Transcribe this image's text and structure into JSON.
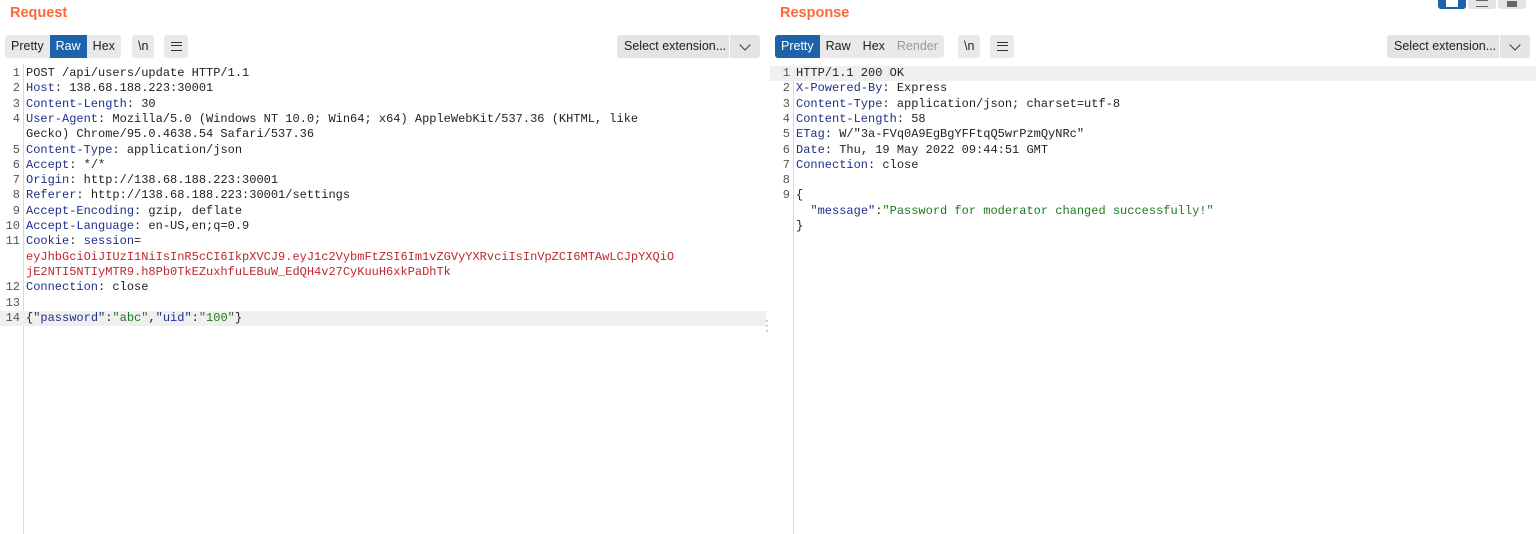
{
  "request": {
    "title": "Request",
    "tabs": [
      "Pretty",
      "Raw",
      "Hex"
    ],
    "active_tab": "Raw",
    "newline_label": "\\n",
    "extension_label": "Select extension...",
    "lines": [
      {
        "n": "1",
        "segs": [
          {
            "t": "POST /api/users/update HTTP/1.1"
          }
        ]
      },
      {
        "n": "2",
        "segs": [
          {
            "t": "Host",
            "c": "k"
          },
          {
            "t": ": 138.68.188.223:30001"
          }
        ]
      },
      {
        "n": "3",
        "segs": [
          {
            "t": "Content-Length",
            "c": "k"
          },
          {
            "t": ": 30"
          }
        ]
      },
      {
        "n": "4",
        "segs": [
          {
            "t": "User-Agent",
            "c": "k"
          },
          {
            "t": ": Mozilla/5.0 (Windows NT 10.0; Win64; x64) AppleWebKit/537.36 (KHTML, like"
          }
        ]
      },
      {
        "n": "",
        "segs": [
          {
            "t": "Gecko) Chrome/95.0.4638.54 Safari/537.36"
          }
        ]
      },
      {
        "n": "5",
        "segs": [
          {
            "t": "Content-Type",
            "c": "k"
          },
          {
            "t": ": application/json"
          }
        ]
      },
      {
        "n": "6",
        "segs": [
          {
            "t": "Accept",
            "c": "k"
          },
          {
            "t": ": */*"
          }
        ]
      },
      {
        "n": "7",
        "segs": [
          {
            "t": "Origin",
            "c": "k"
          },
          {
            "t": ": http://138.68.188.223:30001"
          }
        ]
      },
      {
        "n": "8",
        "segs": [
          {
            "t": "Referer",
            "c": "k"
          },
          {
            "t": ": http://138.68.188.223:30001/settings"
          }
        ]
      },
      {
        "n": "9",
        "segs": [
          {
            "t": "Accept-Encoding",
            "c": "k"
          },
          {
            "t": ": gzip, deflate"
          }
        ]
      },
      {
        "n": "10",
        "segs": [
          {
            "t": "Accept-Language",
            "c": "k"
          },
          {
            "t": ": en-US,en;q=0.9"
          }
        ]
      },
      {
        "n": "11",
        "segs": [
          {
            "t": "Cookie",
            "c": "k"
          },
          {
            "t": ": "
          },
          {
            "t": "session",
            "c": "k"
          },
          {
            "t": "="
          }
        ]
      },
      {
        "n": "",
        "segs": [
          {
            "t": "eyJhbGciOiJIUzI1NiIsInR5cCI6IkpXVCJ9.eyJ1c2VybmFtZSI6Im1vZGVyYXRvciIsInVpZCI6MTAwLCJpYXQiO",
            "c": "red"
          }
        ]
      },
      {
        "n": "",
        "segs": [
          {
            "t": "jE2NTI5NTIyMTR9.h8Pb0TkEZuxhfuLEBuW_EdQH4v27CyKuuH6xkPaDhTk",
            "c": "red"
          }
        ]
      },
      {
        "n": "12",
        "segs": [
          {
            "t": "Connection",
            "c": "k"
          },
          {
            "t": ": close"
          }
        ]
      },
      {
        "n": "13",
        "segs": []
      },
      {
        "n": "14",
        "hl": true,
        "segs": [
          {
            "t": "{"
          },
          {
            "t": "\"password\"",
            "c": "jk"
          },
          {
            "t": ":"
          },
          {
            "t": "\"abc\"",
            "c": "js"
          },
          {
            "t": ","
          },
          {
            "t": "\"uid\"",
            "c": "jk"
          },
          {
            "t": ":"
          },
          {
            "t": "\"100\"",
            "c": "js"
          },
          {
            "t": "}"
          }
        ]
      }
    ]
  },
  "response": {
    "title": "Response",
    "tabs": [
      "Pretty",
      "Raw",
      "Hex",
      "Render"
    ],
    "active_tab": "Pretty",
    "disabled_tab": "Render",
    "newline_label": "\\n",
    "extension_label": "Select extension...",
    "lines": [
      {
        "n": "1",
        "hl": true,
        "segs": [
          {
            "t": "HTTP/1.1 200 OK"
          }
        ]
      },
      {
        "n": "2",
        "segs": [
          {
            "t": "X-Powered-By",
            "c": "k"
          },
          {
            "t": ": Express"
          }
        ]
      },
      {
        "n": "3",
        "segs": [
          {
            "t": "Content-Type",
            "c": "k"
          },
          {
            "t": ": application/json; charset=utf-8"
          }
        ]
      },
      {
        "n": "4",
        "segs": [
          {
            "t": "Content-Length",
            "c": "k"
          },
          {
            "t": ": 58"
          }
        ]
      },
      {
        "n": "5",
        "segs": [
          {
            "t": "ETag",
            "c": "k"
          },
          {
            "t": ": W/\"3a-FVq0A9EgBgYFFtqQ5wrPzmQyNRc\""
          }
        ]
      },
      {
        "n": "6",
        "segs": [
          {
            "t": "Date",
            "c": "k"
          },
          {
            "t": ": Thu, 19 May 2022 09:44:51 GMT"
          }
        ]
      },
      {
        "n": "7",
        "segs": [
          {
            "t": "Connection",
            "c": "k"
          },
          {
            "t": ": close"
          }
        ]
      },
      {
        "n": "8",
        "segs": []
      },
      {
        "n": "9",
        "segs": [
          {
            "t": "{"
          }
        ]
      },
      {
        "n": "",
        "segs": [
          {
            "t": "  "
          },
          {
            "t": "\"message\"",
            "c": "jk"
          },
          {
            "t": ":"
          },
          {
            "t": "\"Password for moderator changed successfully!\"",
            "c": "js"
          }
        ]
      },
      {
        "n": "",
        "segs": [
          {
            "t": "}"
          }
        ]
      }
    ]
  },
  "colors": {
    "accent": "#ff6633",
    "active_tab": "#1e63a9",
    "header_key": "#1f2f8a",
    "cookie_value": "#c0262f",
    "json_string": "#1c7a23"
  }
}
